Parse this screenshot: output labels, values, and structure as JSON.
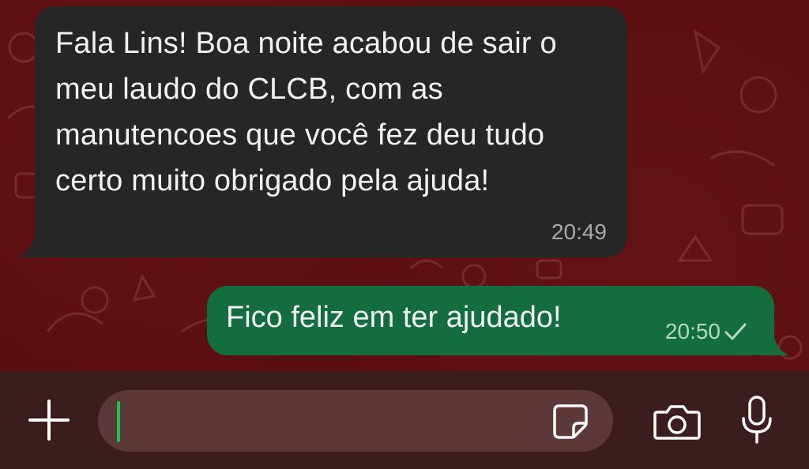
{
  "messages": [
    {
      "direction": "incoming",
      "text": "Fala Lins! Boa noite acabou de sair o meu laudo do CLCB, com as manutencoes que você fez deu tudo certo muito obrigado pela ajuda!",
      "time": "20:49"
    },
    {
      "direction": "outgoing",
      "text": "Fico feliz em ter ajudado!",
      "time": "20:50",
      "status_icon": "single-check-icon"
    }
  ],
  "composer": {
    "placeholder": "",
    "value": "",
    "left_icon": "plus-icon",
    "inline_icon": "sticker-icon",
    "right_icons": [
      "camera-icon",
      "microphone-icon"
    ]
  },
  "colors": {
    "chat_background": "#5b0e11",
    "incoming_bubble": "#262626",
    "outgoing_bubble": "#136d3f",
    "input_bar": "#3c1d1d",
    "cursor": "#1fbf5c"
  }
}
